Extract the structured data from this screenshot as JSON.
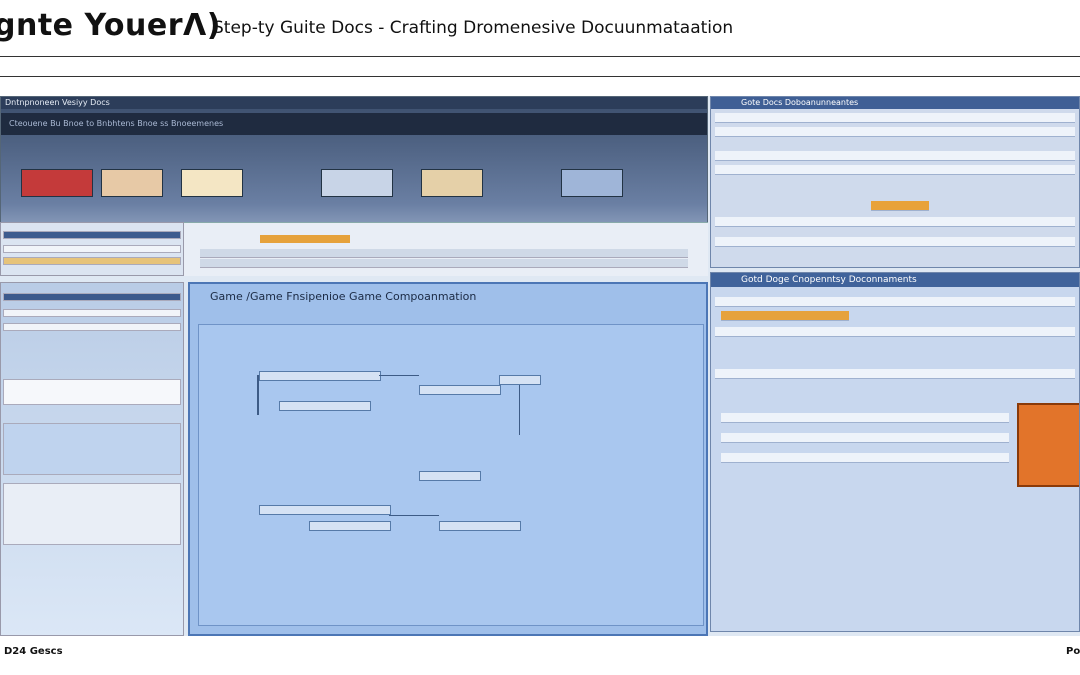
{
  "header": {
    "logo": "gnte YouerΛ)",
    "title": "Step-ty Guite Docs - Crafting Dromenesive Docuunmataation"
  },
  "panels": {
    "left_top": {
      "tab": "Dntnpnoneen Vesiyy Docs",
      "nav": "Cteouene Bu  Bnoe to  Bnbhtens  Bnoe  ss   Bnoeemenes"
    },
    "center": {
      "title": "Game /Game Fnsipenioe Game Compoanmation"
    },
    "right_top": {
      "title": "Gote Docs Doboanunneantes"
    },
    "right_bottom": {
      "title": "Gotd Doge Cnopenntsy Doconnaments"
    }
  },
  "footer": {
    "left": "D24 Gescs",
    "right": "Po"
  },
  "colors": {
    "accent": "#4c76b5",
    "highlight": "#e2742a"
  }
}
